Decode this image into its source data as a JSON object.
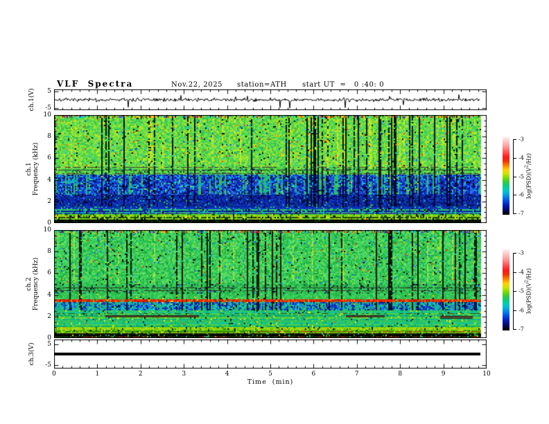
{
  "title": {
    "main": "VLF  Spectra",
    "date": "Nov.22, 2025",
    "station": "station=ATH",
    "start_ut": "start UT  =   0 :40: 0"
  },
  "x_axis": {
    "label": "Time  (min)",
    "ticks": [
      "0",
      "1",
      "2",
      "3",
      "4",
      "5",
      "6",
      "7",
      "8",
      "9",
      "10"
    ],
    "range_min": [
      0,
      10
    ],
    "minor_ticks_per_major": 5
  },
  "panels": {
    "ch1_wave": {
      "ylabel": "ch.1(V)",
      "yticks": [
        "5",
        "-5"
      ],
      "ylim_volts": [
        -5,
        5
      ]
    },
    "spec1": {
      "name_line": "ch.1",
      "freq_line": "Frequency  (kHz)",
      "yticks": [
        "10",
        "8",
        "6",
        "4",
        "2",
        "0"
      ],
      "ylim_khz": [
        0,
        10
      ]
    },
    "spec2": {
      "name_line": "ch.2",
      "freq_line": "Frequency  (kHz)",
      "yticks": [
        "10",
        "8",
        "6",
        "4",
        "2",
        "0"
      ],
      "ylim_khz": [
        0,
        10
      ]
    },
    "ch3_wave": {
      "ylabel": "ch.3(V)",
      "yticks": [
        "5",
        "-5"
      ],
      "ylim_volts": [
        -5,
        5
      ]
    }
  },
  "colorbar": {
    "label_pre": "log(PSD)(V",
    "label_sup": "2",
    "label_post": "/Hz)",
    "ticks": [
      "-3",
      "-4",
      "-5",
      "-6",
      "-7"
    ],
    "range": [
      -7,
      -3
    ]
  },
  "chart_data": [
    {
      "type": "line",
      "title": "ch.1 time series",
      "ylabel": "ch.1(V)",
      "xlabel": "Time (min)",
      "xlim": [
        0,
        10
      ],
      "ylim": [
        -5,
        5
      ],
      "behavior": "noisy baseline near 0 V with frequent impulsive spikes, mostly downward, reaching about -5 V and +4 V",
      "render": {
        "seed": 7,
        "noise_amp": 1.0,
        "spike_down_p": 0.012,
        "spike_up_p": 0.008
      }
    },
    {
      "type": "heatmap",
      "title": "ch.1 spectrogram",
      "ylabel": "ch.1 Frequency (kHz)",
      "xlabel": "Time (min)",
      "xlim": [
        0,
        10
      ],
      "ylim": [
        0,
        10
      ],
      "scale_label": "log(PSD)(V2/Hz)",
      "scale_range": [
        -7,
        -3
      ],
      "render": {
        "seed": 1234,
        "col_deep_p": 0.035,
        "col_dark_p": 0.1,
        "col_green_p": 0.22,
        "col_bright_p": 0.07,
        "top_noise": [
          "#ff4400",
          "#ffcc00",
          "#19c7ff",
          "#2244ff",
          "#33cc44",
          "#cc0011",
          "#8ce23a"
        ],
        "bands": [
          {
            "f": [
              5.05,
              10
            ],
            "mode": "cells",
            "colfx": true,
            "dark": "#04140a",
            "bright_color": "#cfe51c",
            "palette": [
              [
                "#4fd948",
                3
              ],
              [
                "#63df55",
                3
              ],
              [
                "#8ce23a",
                2
              ],
              [
                "#abe52a",
                1.5
              ],
              [
                "#3cc85a",
                2
              ],
              [
                "#2eb94e",
                1
              ],
              [
                "#c9e816",
                0.7
              ]
            ],
            "specks": [
              [
                "#ff2e00",
                0.006
              ],
              [
                "#ff9500",
                0.007
              ],
              [
                "#19c7ff",
                0.012
              ],
              [
                "#0a0a0a",
                0.02
              ],
              [
                "#1256d6",
                0.008
              ]
            ]
          },
          {
            "f": [
              4.5,
              5.05
            ],
            "mode": "cells",
            "colfx": true,
            "dark": "#04140a",
            "palette": [
              [
                "#4fd948",
                3
              ],
              [
                "#63df55",
                2
              ],
              [
                "#8ce23a",
                1.5
              ],
              [
                "#36c152",
                2
              ],
              [
                "#2a7c3a",
                1
              ]
            ],
            "specks": [
              [
                "#222222",
                0.05
              ],
              [
                "#1256d6",
                0.02
              ]
            ]
          },
          {
            "f": [
              2.6,
              4.5
            ],
            "mode": "cells",
            "colfx": true,
            "dark": "#020b33",
            "green_palette": [
              "#25c06a",
              "#12b38a",
              "#3ec24e"
            ],
            "palette": [
              [
                "#1538cf",
                3
              ],
              [
                "#2050e8",
                2
              ],
              [
                "#0d9fe8",
                1.3
              ],
              [
                "#0a1a9a",
                2.2
              ],
              [
                "#0ccfc2",
                0.8
              ],
              [
                "#2f6ee0",
                1.2
              ],
              [
                "#071060",
                1.5
              ]
            ],
            "specks": [
              [
                "#63df55",
                0.02
              ],
              [
                "#000000",
                0.025
              ],
              [
                "#ffd400",
                0.004
              ]
            ]
          },
          {
            "f": [
              1.55,
              2.6
            ],
            "mode": "cells",
            "colfx": true,
            "dark": "#020826",
            "palette": [
              [
                "#0b23af",
                3
              ],
              [
                "#0e32c2",
                2
              ],
              [
                "#060e66",
                2.4
              ],
              [
                "#1b47d0",
                1
              ],
              [
                "#083055",
                0.8
              ],
              [
                "#0a46a0",
                1
              ]
            ],
            "specks": [
              [
                "#0abdc8",
                0.02
              ],
              [
                "#2fc160",
                0.012
              ],
              [
                "#000000",
                0.02
              ]
            ]
          },
          {
            "f": [
              0.85,
              1.55
            ],
            "mode": "rows",
            "jitter": 0.3,
            "palette": [
              "#0a2bb2",
              "#0e3ac4",
              "#33cc66",
              "#0a2090",
              "#0ab0b8",
              "#0c2fb0",
              "#15984a"
            ],
            "specks": [
              [
                "#2fc160",
                0.04
              ],
              [
                "#000000",
                0.03
              ]
            ]
          },
          {
            "f": [
              0.32,
              0.85
            ],
            "mode": "rows",
            "jitter": 0.3,
            "palette": [
              "#57cf1d",
              "#9cdc12",
              "#1e4a04",
              "#7ccf2e",
              "#0c3b0c",
              "#b4dd26",
              "#2e7a10"
            ],
            "specks": [
              [
                "#e8e400",
                0.04
              ],
              [
                "#000000",
                0.05
              ],
              [
                "#ff5500",
                0.006
              ]
            ]
          },
          {
            "f": [
              0,
              0.32
            ],
            "mode": "rows",
            "jitter": 0.15,
            "palette": [
              "#000000",
              "#051505",
              "#000000",
              "#0a260a"
            ],
            "specks": [
              [
                "#0e4f12",
                0.08
              ]
            ]
          }
        ],
        "hlines": [
          {
            "f": 4.92,
            "c": "#30302e",
            "p": 0.8
          },
          {
            "f": 5.22,
            "c": "#3a3a38",
            "p": 0.55
          },
          {
            "f": 4.62,
            "c": "#58333c",
            "p": 0.5
          },
          {
            "f": 0.95,
            "c": "#6a6a62",
            "p": 0.6
          }
        ],
        "bars": []
      }
    },
    {
      "type": "heatmap",
      "title": "ch.2 spectrogram",
      "ylabel": "ch.2 Frequency (kHz)",
      "xlabel": "Time (min)",
      "xlim": [
        0,
        10
      ],
      "ylim": [
        0,
        10
      ],
      "scale_label": "log(PSD)(V2/Hz)",
      "scale_range": [
        -7,
        -3
      ],
      "render": {
        "seed": 9876,
        "col_deep_p": 0.03,
        "col_dark_p": 0.085,
        "col_green_p": 0.18,
        "col_bright_p": 0.05,
        "top_noise": [
          "#ff4400",
          "#ffcc00",
          "#19c7ff",
          "#2244ff",
          "#33cc44",
          "#cc0011",
          "#8ce23a"
        ],
        "bands": [
          {
            "f": [
              5.0,
              10
            ],
            "mode": "cells",
            "colfx": true,
            "dark": "#04140a",
            "bright_color": "#a8e03a",
            "palette": [
              [
                "#30c653",
                3
              ],
              [
                "#41d463",
                3
              ],
              [
                "#52dc70",
                2
              ],
              [
                "#6ade55",
                1.2
              ],
              [
                "#24b545",
                2
              ],
              [
                "#8ce23a",
                0.6
              ],
              [
                "#15a53c",
                1
              ]
            ],
            "specks": [
              [
                "#ff3300",
                0.004
              ],
              [
                "#ffaa00",
                0.005
              ],
              [
                "#2563f0",
                0.012
              ],
              [
                "#0a0a0a",
                0.018
              ],
              [
                "#0ccfc2",
                0.01
              ]
            ]
          },
          {
            "f": [
              4.1,
              5.0
            ],
            "mode": "cells",
            "colfx": true,
            "dark": "#04140a",
            "palette": [
              [
                "#30c653",
                3
              ],
              [
                "#41d463",
                2
              ],
              [
                "#24b545",
                2
              ],
              [
                "#1d8a3a",
                1
              ]
            ],
            "specks": [
              [
                "#17335c",
                0.05
              ],
              [
                "#0a0a0a",
                0.04
              ],
              [
                "#2563f0",
                0.02
              ]
            ]
          },
          {
            "f": [
              3.62,
              4.1
            ],
            "mode": "cells",
            "colfx": true,
            "dark": "#04140a",
            "palette": [
              [
                "#30c653",
                3
              ],
              [
                "#41d463",
                2
              ],
              [
                "#52dc70",
                1
              ],
              [
                "#24b545",
                2
              ]
            ],
            "specks": [
              [
                "#ffd400",
                0.01
              ],
              [
                "#0a0a0a",
                0.02
              ]
            ]
          },
          {
            "f": [
              3.32,
              3.62
            ],
            "mode": "cells",
            "colfx": false,
            "palette": [
              [
                "#f32300",
                3
              ],
              [
                "#e04400",
                2
              ],
              [
                "#c21a00",
                1.6
              ],
              [
                "#ff7a00",
                1
              ],
              [
                "#d83300",
                1.4
              ],
              [
                "#2eb94e",
                0.7
              ],
              [
                "#a81400",
                0.8
              ]
            ],
            "specks": [
              [
                "#ffd400",
                0.02
              ]
            ]
          },
          {
            "f": [
              2.55,
              3.32
            ],
            "mode": "cells",
            "colfx": true,
            "dark": "#031233",
            "green_palette": [
              "#25c06a",
              "#12b38a"
            ],
            "palette": [
              [
                "#1544cc",
                2
              ],
              [
                "#0d9fd8",
                1.8
              ],
              [
                "#1fc490",
                1.4
              ],
              [
                "#0a1f9a",
                1.6
              ],
              [
                "#2eb94e",
                1
              ],
              [
                "#0ccfc2",
                0.8
              ],
              [
                "#2f6ee0",
                1
              ]
            ],
            "specks": [
              [
                "#000000",
                0.025
              ],
              [
                "#ffd400",
                0.006
              ]
            ]
          },
          {
            "f": [
              1.0,
              2.55
            ],
            "mode": "rows",
            "jitter": 0.35,
            "palette": [
              "#2fc862",
              "#0cc49e",
              "#4ed342",
              "#0aa877",
              "#22b95a",
              "#6ed634",
              "#0bb68a",
              "#34c05a"
            ],
            "specks": [
              [
                "#f2ea00",
                0.02
              ],
              [
                "#ff5500",
                0.005
              ],
              [
                "#0a3f66",
                0.02
              ],
              [
                "#0a0a0a",
                0.012
              ]
            ]
          },
          {
            "f": [
              0.42,
              1.0
            ],
            "mode": "rows",
            "jitter": 0.3,
            "palette": [
              "#86d30a",
              "#a8dc14",
              "#52b802",
              "#2c8c04",
              "#c4e422",
              "#157a06",
              "#9cdc12"
            ],
            "specks": [
              [
                "#0a0a0a",
                0.04
              ],
              [
                "#ff8800",
                0.008
              ]
            ]
          },
          {
            "f": [
              0,
              0.42
            ],
            "mode": "rows",
            "jitter": 0.2,
            "palette": [
              "#041504",
              "#000000",
              "#0a2e0a",
              "#000000",
              "#062006"
            ],
            "specks": [
              [
                "#22aa33",
                0.06
              ],
              [
                "#0ab5a5",
                0.03
              ],
              [
                "#e0e000",
                0.01
              ]
            ]
          }
        ],
        "hlines": [
          {
            "f": 4.7,
            "c": "#2e2e2c",
            "p": 0.85
          },
          {
            "f": 4.42,
            "c": "#3c3c30",
            "p": 0.7
          },
          {
            "f": 2.32,
            "c": "#2a4c20",
            "p": 0.4
          },
          {
            "f": 0.62,
            "c": "#e04a00",
            "p": 0.55,
            "x0": 0.45
          },
          {
            "f": 0.1,
            "c": "#a01800",
            "p": 0.5
          }
        ],
        "bars": [
          {
            "t": [
              1.2,
              3.4
            ],
            "f": [
              1.9,
              2.12
            ],
            "c": "#5a4a30"
          },
          {
            "t": [
              6.85,
              7.75
            ],
            "f": [
              1.9,
              2.12
            ],
            "c": "#5a4a30"
          },
          {
            "t": [
              9.05,
              9.82
            ],
            "f": [
              1.82,
              2.05
            ],
            "c": "#5a4a30"
          }
        ]
      }
    },
    {
      "type": "line",
      "title": "ch.3 time series",
      "ylabel": "ch.3(V)",
      "xlabel": "Time (min)",
      "xlim": [
        0,
        10
      ],
      "ylim": [
        -5,
        5
      ],
      "behavior": "constant flat thick line at 0 V for the whole record",
      "render": {
        "line_value": 0,
        "thickness_px": 4
      }
    }
  ]
}
